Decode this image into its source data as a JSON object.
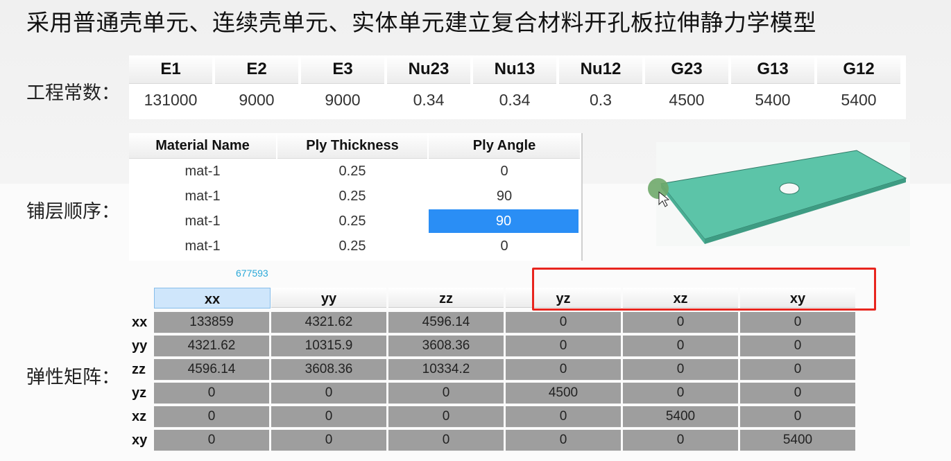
{
  "title": "采用普通壳单元、连续壳单元、实体单元建立复合材料开孔板拉伸静力学模型",
  "labels": {
    "engineering_constants": "工程常数：",
    "ply_sequence": "铺层顺序：",
    "stiffness_matrix": "弹性矩阵："
  },
  "engineering_constants": {
    "headers": [
      "E1",
      "E2",
      "E3",
      "Nu23",
      "Nu13",
      "Nu12",
      "G23",
      "G13",
      "G12"
    ],
    "values": [
      "131000",
      "9000",
      "9000",
      "0.34",
      "0.34",
      "0.3",
      "4500",
      "5400",
      "5400"
    ]
  },
  "ply_table": {
    "headers": [
      "Material Name",
      "Ply Thickness",
      "Ply Angle"
    ],
    "rows": [
      [
        "mat-1",
        "0.25",
        "0"
      ],
      [
        "mat-1",
        "0.25",
        "90"
      ],
      [
        "mat-1",
        "0.25",
        "90"
      ],
      [
        "mat-1",
        "0.25",
        "0"
      ]
    ],
    "selected_row": 2
  },
  "floating_number": "677593",
  "matrix": {
    "col_headers": [
      "xx",
      "yy",
      "zz",
      "yz",
      "xz",
      "xy"
    ],
    "row_headers": [
      "xx",
      "yy",
      "zz",
      "yz",
      "xz",
      "xy"
    ],
    "rows": [
      [
        "133859",
        "4321.62",
        "4596.14",
        "0",
        "0",
        "0"
      ],
      [
        "4321.62",
        "10315.9",
        "3608.36",
        "0",
        "0",
        "0"
      ],
      [
        "4596.14",
        "3608.36",
        "10334.2",
        "0",
        "0",
        "0"
      ],
      [
        "0",
        "0",
        "0",
        "4500",
        "0",
        "0"
      ],
      [
        "0",
        "0",
        "0",
        "0",
        "5400",
        "0"
      ],
      [
        "0",
        "0",
        "0",
        "0",
        "0",
        "5400"
      ]
    ],
    "active_column": 0
  },
  "colors": {
    "plate": "#5cc4a8",
    "selection": "#2a8ef5",
    "highlight_box": "#e8251e",
    "matrix_cell": "#9e9e9e"
  }
}
